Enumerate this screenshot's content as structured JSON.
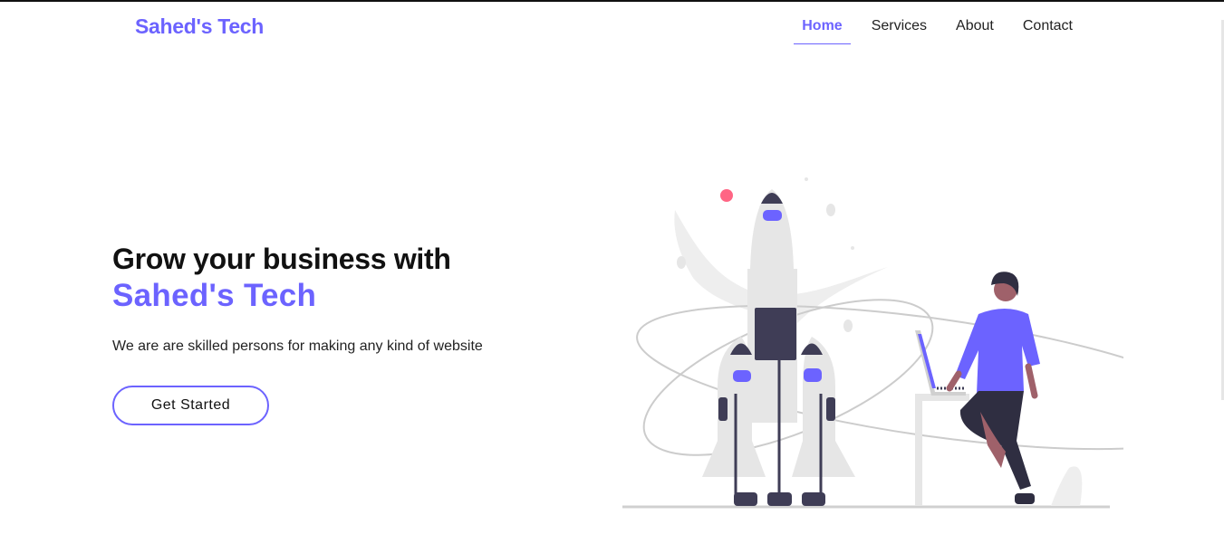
{
  "brand": {
    "name": "Sahed's Tech"
  },
  "nav": {
    "items": [
      {
        "label": "Home",
        "active": true
      },
      {
        "label": "Services",
        "active": false
      },
      {
        "label": "About",
        "active": false
      },
      {
        "label": "Contact",
        "active": false
      }
    ]
  },
  "hero": {
    "heading_line1": "Grow your business with",
    "heading_line2": "Sahed's Tech",
    "subtitle": "We are are skilled persons for making any kind of website",
    "cta_label": "Get Started"
  },
  "illustration": {
    "icon": "rocket-launch-illustration"
  },
  "colors": {
    "accent": "#6c63ff",
    "text": "#111111",
    "illustration_dark": "#3f3d56",
    "illustration_gray": "#e6e6e6",
    "red_dot": "#ff6584"
  }
}
